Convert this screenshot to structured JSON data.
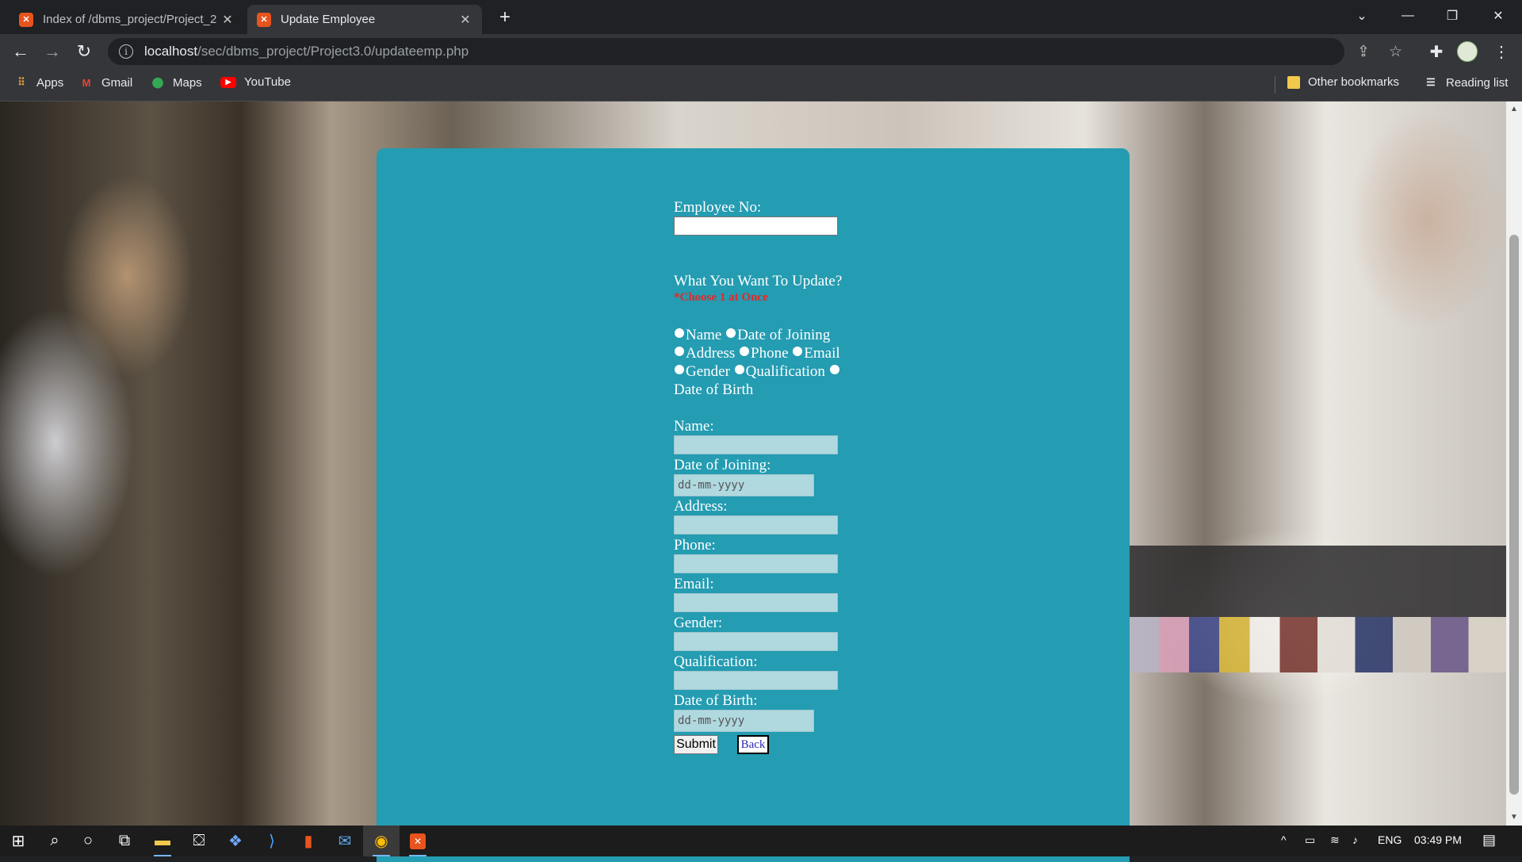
{
  "browser": {
    "tabs": [
      {
        "title": "Index of /dbms_project/Project_2",
        "favicon": "xampp-icon",
        "active": false
      },
      {
        "title": "Update Employee",
        "favicon": "xampp-icon",
        "active": true
      }
    ],
    "url_host": "localhost",
    "url_path": "/sec/dbms_project/Project3.0/updateemp.php",
    "bookmarks": [
      {
        "label": "Apps",
        "icon": "apps-grid-icon"
      },
      {
        "label": "Gmail",
        "icon": "gmail-icon"
      },
      {
        "label": "Maps",
        "icon": "maps-icon"
      },
      {
        "label": "YouTube",
        "icon": "youtube-icon"
      }
    ],
    "other_bookmarks": "Other bookmarks",
    "reading_list": "Reading list"
  },
  "form": {
    "empno_label": "Employee No:",
    "empno_value": "",
    "question": "What You Want To Update?",
    "warning": "*Choose 1 at Once",
    "options": [
      "Name",
      "Date of Joining",
      "Address",
      "Phone",
      "Email",
      "Gender",
      "Qualification",
      "Date of Birth"
    ],
    "fields": {
      "name_label": "Name:",
      "doj_label": "Date of Joining:",
      "doj_placeholder": "dd-mm-yyyy",
      "address_label": "Address:",
      "phone_label": "Phone:",
      "email_label": "Email:",
      "gender_label": "Gender:",
      "qualification_label": "Qualification:",
      "dob_label": "Date of Birth:",
      "dob_placeholder": "dd-mm-yyyy"
    },
    "submit_label": "Submit",
    "back_label": "Back"
  },
  "taskbar": {
    "language": "ENG",
    "time": "03:49 PM"
  },
  "colors": {
    "panel": "#249cb2",
    "warning": "#e32828",
    "disabled_field": "#afd8df"
  }
}
